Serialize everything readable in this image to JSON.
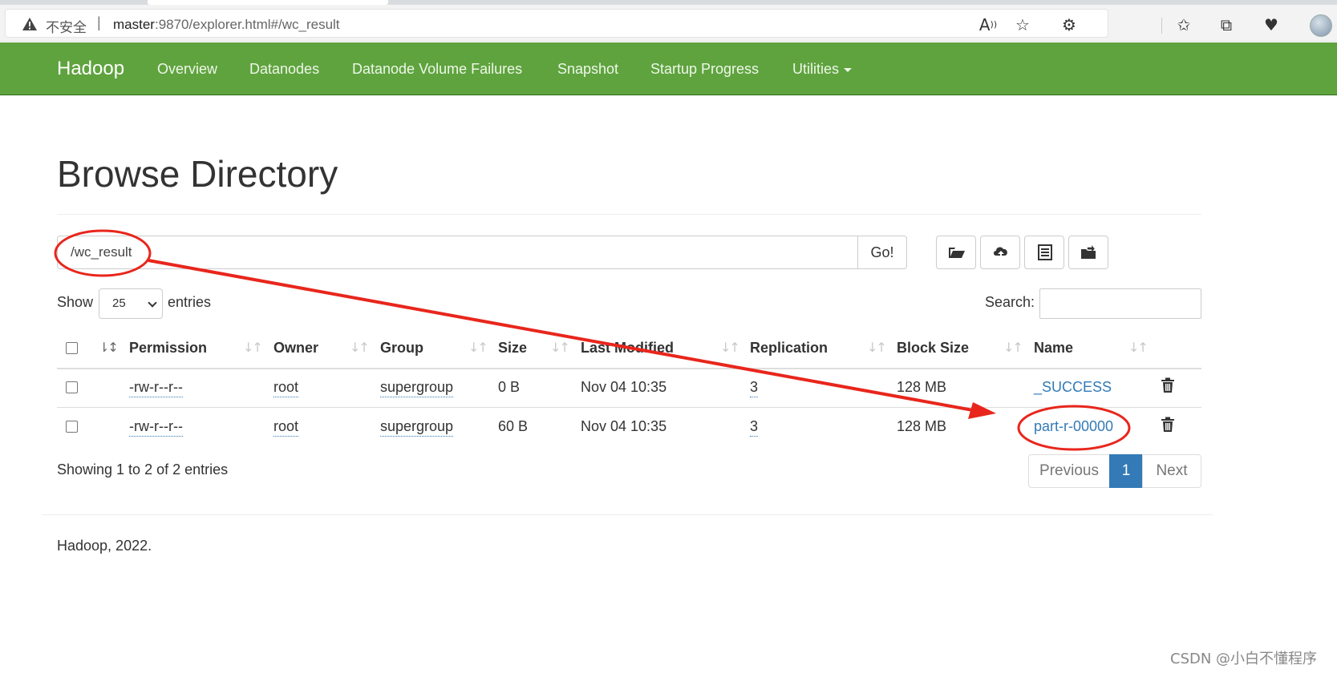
{
  "browser": {
    "insecure_label": "不安全",
    "url_host": "master",
    "url_rest": ":9870/explorer.html#/wc_result"
  },
  "navbar": {
    "brand": "Hadoop",
    "items": [
      "Overview",
      "Datanodes",
      "Datanode Volume Failures",
      "Snapshot",
      "Startup Progress",
      "Utilities"
    ]
  },
  "page": {
    "title": "Browse Directory",
    "path_value": "/wc_result",
    "go_label": "Go!"
  },
  "table_controls": {
    "show_label": "Show",
    "page_length": "25",
    "entries_label": "entries",
    "search_label": "Search:"
  },
  "table": {
    "columns": [
      "Permission",
      "Owner",
      "Group",
      "Size",
      "Last Modified",
      "Replication",
      "Block Size",
      "Name"
    ],
    "rows": [
      {
        "permission": "-rw-r--r--",
        "owner": "root",
        "group": "supergroup",
        "size": "0 B",
        "modified": "Nov 04 10:35",
        "replication": "3",
        "block_size": "128 MB",
        "name": "_SUCCESS"
      },
      {
        "permission": "-rw-r--r--",
        "owner": "root",
        "group": "supergroup",
        "size": "60 B",
        "modified": "Nov 04 10:35",
        "replication": "3",
        "block_size": "128 MB",
        "name": "part-r-00000"
      }
    ]
  },
  "pagination": {
    "info": "Showing 1 to 2 of 2 entries",
    "previous": "Previous",
    "current": "1",
    "next": "Next"
  },
  "footer": "Hadoop, 2022.",
  "watermark": "CSDN @小白不懂程序",
  "colors": {
    "navbar": "#5fa33e",
    "link": "#337ab7",
    "annotation": "#e8261c"
  }
}
